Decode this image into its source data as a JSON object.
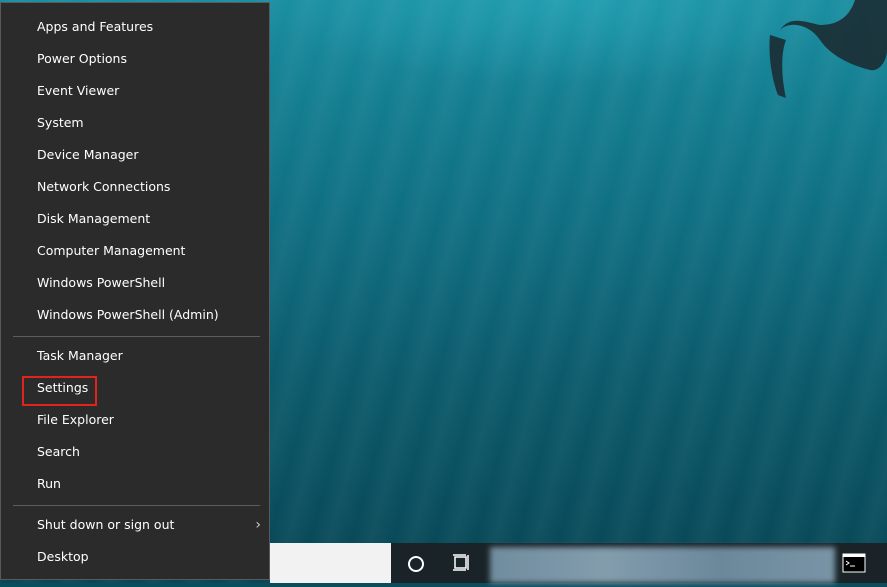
{
  "menu": {
    "group1": [
      {
        "label": "Apps and Features"
      },
      {
        "label": "Power Options"
      },
      {
        "label": "Event Viewer"
      },
      {
        "label": "System"
      },
      {
        "label": "Device Manager"
      },
      {
        "label": "Network Connections"
      },
      {
        "label": "Disk Management"
      },
      {
        "label": "Computer Management"
      },
      {
        "label": "Windows PowerShell"
      },
      {
        "label": "Windows PowerShell (Admin)"
      }
    ],
    "group2": [
      {
        "label": "Task Manager"
      },
      {
        "label": "Settings"
      },
      {
        "label": "File Explorer"
      },
      {
        "label": "Search"
      },
      {
        "label": "Run"
      }
    ],
    "group3": [
      {
        "label": "Shut down or sign out",
        "has_submenu": true
      },
      {
        "label": "Desktop"
      }
    ],
    "highlighted_item": "Settings",
    "highlight_color": "#e0241c"
  },
  "taskbar": {
    "icons": [
      "cortana-icon",
      "task-view-icon",
      "command-prompt-icon"
    ]
  }
}
